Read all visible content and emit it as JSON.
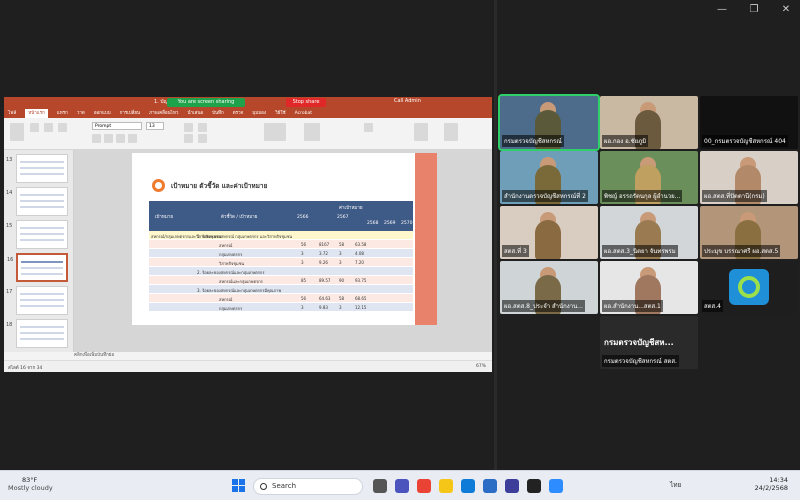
{
  "window": {
    "controls": [
      "—",
      "❐",
      "✕"
    ]
  },
  "share": {
    "app_title": "1. บัญชี...",
    "sharing_banner": "You are screen sharing",
    "stop_share": "Stop share",
    "user": "Call Admin",
    "tabs": [
      "ไฟล์",
      "หน้าแรก",
      "แทรก",
      "วาด",
      "ออกแบบ",
      "การเปลี่ยน",
      "ภาพเคลื่อนไหว",
      "นำเสนอ",
      "บันทึก",
      "ตรวจ",
      "มุมมอง",
      "วิธีใช้",
      "Acrobat"
    ],
    "font_name": "Prompt",
    "font_size": "13",
    "slide_numbers": [
      "13",
      "14",
      "15",
      "16",
      "17",
      "18"
    ],
    "selected_slide": "16",
    "slide": {
      "heading": "เป้าหมาย ตัวชี้วัด และค่าเป้าหมาย",
      "col1": "เป้าหมาย",
      "col2": "ตัวชี้วัด / เป้าหมาย",
      "col3": "ค่าเป้าหมาย",
      "years": [
        "2566",
        "2567",
        "2568",
        "2569",
        "2570"
      ],
      "rows": [
        [
          "สหกรณ์/กลุ่มเกษตรกรและวิสาหกิจชุมชน",
          "1. ร้อยละของสหกรณ์ กลุ่มเกษตรกร และวิสาหกิจชุมชน",
          "",
          "",
          "",
          ""
        ],
        [
          "",
          "สหกรณ์",
          "56",
          "8167",
          "58",
          "63.58"
        ],
        [
          "",
          "กลุ่มเกษตรกร",
          "3",
          "3.72",
          "3",
          "4.08"
        ],
        [
          "",
          "วิสาหกิจชุมชน",
          "3",
          "9.26",
          "3",
          "7.20"
        ],
        [
          "",
          "2. ร้อยละของสหกรณ์และกลุ่มเกษตรกร",
          "",
          "",
          "",
          ""
        ],
        [
          "",
          "สหกรณ์และกลุ่มเกษตรกร",
          "85",
          "89.57",
          "90",
          "93.75"
        ],
        [
          "",
          "3. ร้อยละของสหกรณ์และกลุ่มเกษตรกรมีคุณภาพ",
          "",
          "",
          "",
          ""
        ],
        [
          "",
          "สหกรณ์",
          "56",
          "64.63",
          "58",
          "68.65"
        ],
        [
          "",
          "กลุ่มเกษตรกร",
          "3",
          "9.83",
          "3",
          "12.15"
        ]
      ]
    },
    "notes": "คลิกเพื่อเพิ่มบันทึกย่อ",
    "status": "สไลด์ 16 จาก 34",
    "zoom": "67%"
  },
  "participants": [
    {
      "name": "กรมตรวจบัญชีสหกรณ์",
      "active": true
    },
    {
      "name": "ผอ.กอง อ.ชัยภูมิ",
      "active": false
    },
    {
      "name": "00_กรมตรวจบัญชีสหกรณ์ 404",
      "active": false
    },
    {
      "name": "สำนักงานตรวจบัญชีสหกรณ์ที่ 2",
      "active": false
    },
    {
      "name": "พิชญ์ อรรถรัตนกุล ผู้อำนวย...",
      "active": false
    },
    {
      "name": "ผอ.สตส.ที่ปัตตานี(กรม)",
      "active": false
    },
    {
      "name": "สตส.ที่ 3",
      "active": false
    },
    {
      "name": "ผอ.สตส.3_นิตยา จันทรพรม",
      "active": false
    },
    {
      "name": "ประมุข บรรณาศรี ผอ.สตส.5",
      "active": false
    },
    {
      "name": "ผอ.สตส.8_ประจำ สำนักงาน...",
      "active": false
    },
    {
      "name": "ผอ.สำนักงาน...สตส.1",
      "active": false
    },
    {
      "name": "สตส.4",
      "active": false
    }
  ],
  "text_tile": {
    "big": "กรมตรวจบัญชีสห...",
    "name": "กรมตรวจบัญชีสหกรณ์ สตส."
  },
  "taskbar": {
    "temp": "83°F",
    "condition": "Mostly cloudy",
    "search": "Search",
    "lang": "ไทย",
    "time": "14:34",
    "date": "24/2/2568"
  }
}
